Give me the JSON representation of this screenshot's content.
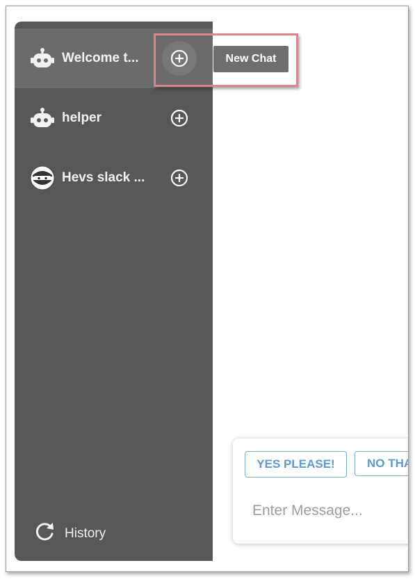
{
  "sidebar": {
    "items": [
      {
        "label": "Welcome t...",
        "avatar": "robot-icon",
        "add_icon": "plus-circle-icon"
      },
      {
        "label": "helper",
        "avatar": "robot-icon",
        "add_icon": "plus-circle-icon"
      },
      {
        "label": "Hevs slack ...",
        "avatar": "ninja-avatar-icon",
        "add_icon": "plus-circle-icon"
      }
    ],
    "history_label": "History",
    "history_icon": "refresh-icon"
  },
  "tooltip": {
    "label": "New Chat"
  },
  "composer": {
    "suggestions": [
      "YES PLEASE!",
      "NO THA"
    ],
    "placeholder": "Enter Message..."
  },
  "colors": {
    "sidebar_bg": "#575757",
    "active_row_bg": "#6b6b6b",
    "suggestion_blue": "#5b9bd1",
    "highlight_red": "#d6868c"
  }
}
